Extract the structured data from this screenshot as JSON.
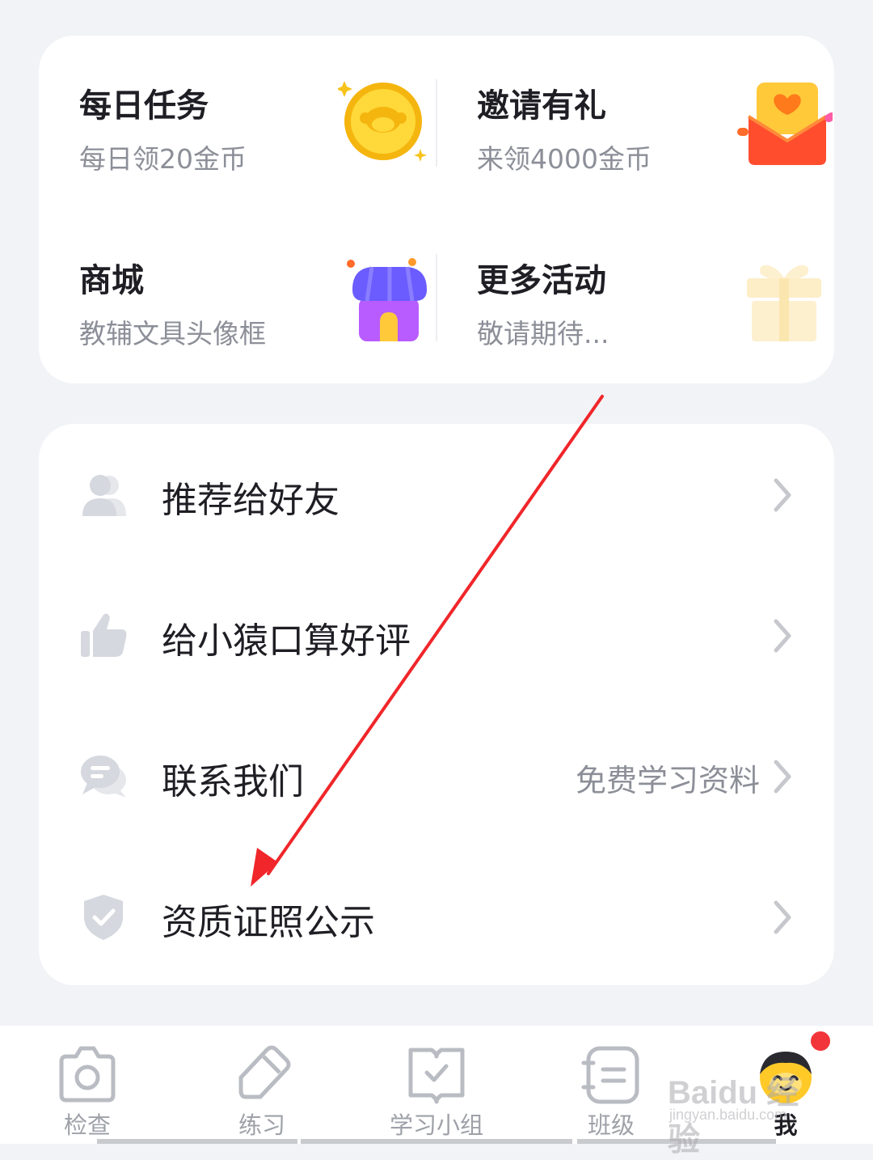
{
  "activities": [
    {
      "title": "每日任务",
      "subtitle": "每日领20金币",
      "icon": "gold-coin-icon"
    },
    {
      "title": "邀请有礼",
      "subtitle": "来领4000金币",
      "icon": "gift-envelope-icon"
    },
    {
      "title": "商城",
      "subtitle": "教辅文具头像框",
      "icon": "shop-icon"
    },
    {
      "title": "更多活动",
      "subtitle": "敬请期待...",
      "icon": "gift-box-icon"
    }
  ],
  "menu": [
    {
      "label": "推荐给好友",
      "extra": "",
      "icon": "user-icon"
    },
    {
      "label": "给小猿口算好评",
      "extra": "",
      "icon": "thumbs-up-icon"
    },
    {
      "label": "联系我们",
      "extra": "免费学习资料",
      "icon": "chat-bubble-icon"
    },
    {
      "label": "资质证照公示",
      "extra": "",
      "icon": "shield-check-icon"
    }
  ],
  "tabs": [
    {
      "label": "检查",
      "icon": "camera-icon",
      "active": false
    },
    {
      "label": "练习",
      "icon": "pencil-icon",
      "active": false
    },
    {
      "label": "学习小组",
      "icon": "book-check-icon",
      "active": false
    },
    {
      "label": "班级",
      "icon": "notebook-icon",
      "active": false
    },
    {
      "label": "我",
      "icon": "mascot-avatar-icon",
      "active": true
    }
  ],
  "watermark": {
    "logo": "Baidu 经验",
    "url": "jingyan.baidu.com"
  },
  "colors": {
    "background": "#f2f3f7",
    "card": "#ffffff",
    "text_primary": "#1e1e24",
    "text_secondary": "#8c8f98",
    "icon_gray": "#d5d8de",
    "badge": "#f2353a",
    "annotation_arrow": "#f0262a"
  }
}
